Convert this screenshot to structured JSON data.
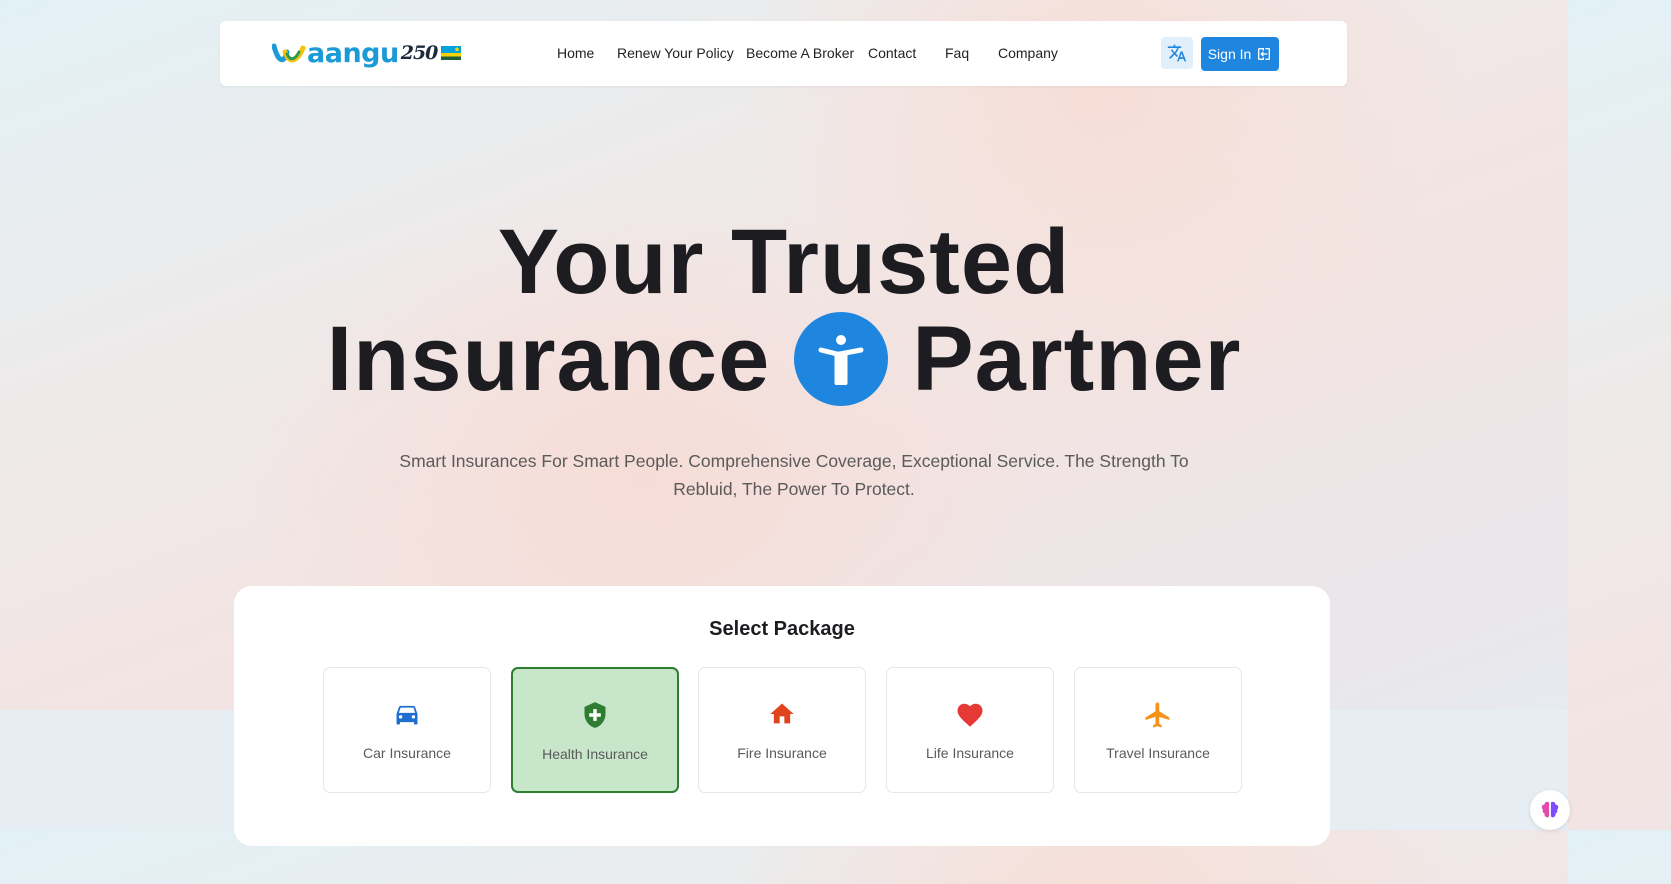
{
  "header": {
    "logo": {
      "text": "aangu",
      "number": "250"
    },
    "nav": [
      {
        "label": "Home"
      },
      {
        "label": "Renew Your Policy"
      },
      {
        "label": "Become A Broker"
      },
      {
        "label": "Contact"
      },
      {
        "label": "Faq"
      },
      {
        "label": "Company"
      }
    ],
    "translate_icon": "translate-icon",
    "signin_label": "Sign In",
    "signin_icon": "login-icon"
  },
  "hero": {
    "line1": "Your Trusted",
    "line2_left": "Insurance",
    "line2_right": "Partner",
    "center_icon": "accessibility-icon",
    "subtitle": "Smart Insurances For Smart People. Comprehensive Coverage, Exceptional Service. The Strength To Rebluid, The Power To Protect."
  },
  "packages": {
    "title": "Select Package",
    "items": [
      {
        "label": "Car Insurance",
        "icon": "car-icon",
        "color": "#1f6fd0",
        "selected": false
      },
      {
        "label": "Health Insurance",
        "icon": "health-shield-icon",
        "color": "#2e7d32",
        "selected": true
      },
      {
        "label": "Fire Insurance",
        "icon": "house-icon",
        "color": "#e0441c",
        "selected": false
      },
      {
        "label": "Life Insurance",
        "icon": "heart-icon",
        "color": "#e53935",
        "selected": false
      },
      {
        "label": "Travel Insurance",
        "icon": "airplane-icon",
        "color": "#f4921a",
        "selected": false
      }
    ]
  },
  "colors": {
    "primary": "#1f86e0",
    "selected_bg": "#c8e6c9",
    "selected_border": "#2e7d32"
  }
}
